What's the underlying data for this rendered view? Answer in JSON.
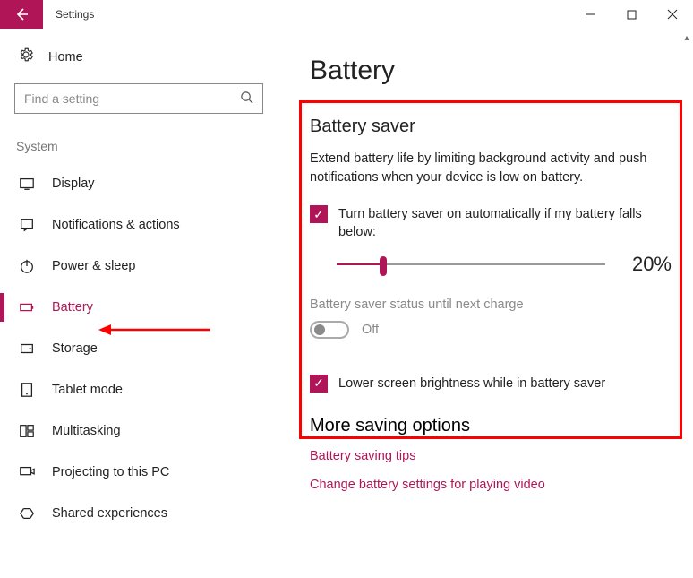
{
  "app": {
    "title": "Settings"
  },
  "home_label": "Home",
  "search": {
    "placeholder": "Find a setting"
  },
  "section_label": "System",
  "nav": [
    {
      "label": "Display"
    },
    {
      "label": "Notifications & actions"
    },
    {
      "label": "Power & sleep"
    },
    {
      "label": "Battery"
    },
    {
      "label": "Storage"
    },
    {
      "label": "Tablet mode"
    },
    {
      "label": "Multitasking"
    },
    {
      "label": "Projecting to this PC"
    },
    {
      "label": "Shared experiences"
    }
  ],
  "page": {
    "title": "Battery",
    "saver_heading": "Battery saver",
    "saver_desc": "Extend battery life by limiting background activity and push notifications when your device is low on battery.",
    "auto_on_label": "Turn battery saver on automatically if my battery falls below:",
    "auto_on_checked": true,
    "threshold_percent": "20%",
    "status_label": "Battery saver status until next charge",
    "status_value": "Off",
    "lower_brightness_label": "Lower screen brightness while in battery saver",
    "lower_brightness_checked": true,
    "more_heading": "More saving options",
    "link_tips": "Battery saving tips",
    "link_video": "Change battery settings for playing video"
  },
  "colors": {
    "accent": "#b01657"
  }
}
